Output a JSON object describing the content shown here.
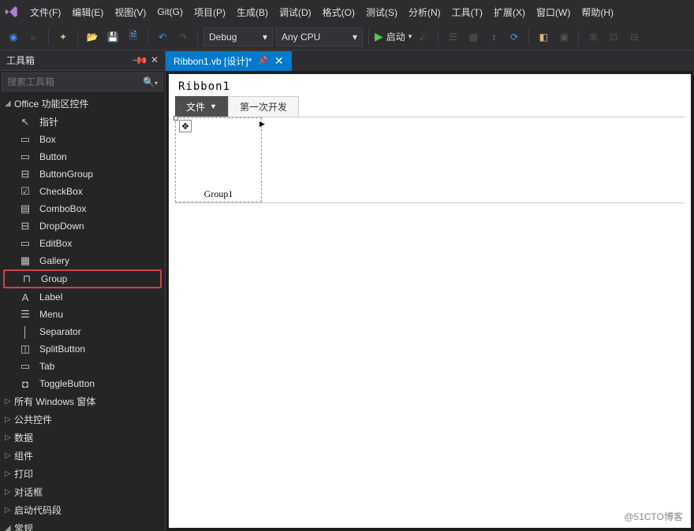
{
  "menubar": {
    "items": [
      "文件(F)",
      "编辑(E)",
      "视图(V)",
      "Git(G)",
      "项目(P)",
      "生成(B)",
      "调试(D)",
      "格式(O)",
      "测试(S)",
      "分析(N)",
      "工具(T)",
      "扩展(X)",
      "窗口(W)",
      "帮助(H)"
    ]
  },
  "toolbar": {
    "debug": "Debug",
    "cpu": "Any CPU",
    "start": "启动"
  },
  "sidebar": {
    "title": "工具箱",
    "search_placeholder": "搜索工具箱",
    "categories": {
      "office": "Office 功能区控件",
      "items": [
        {
          "icon": "pointer",
          "label": "指针"
        },
        {
          "icon": "box",
          "label": "Box"
        },
        {
          "icon": "button",
          "label": "Button"
        },
        {
          "icon": "btngrp",
          "label": "ButtonGroup"
        },
        {
          "icon": "check",
          "label": "CheckBox"
        },
        {
          "icon": "combo",
          "label": "ComboBox"
        },
        {
          "icon": "drop",
          "label": "DropDown"
        },
        {
          "icon": "edit",
          "label": "EditBox"
        },
        {
          "icon": "gallery",
          "label": "Gallery"
        },
        {
          "icon": "group",
          "label": "Group",
          "highlight": true
        },
        {
          "icon": "label",
          "label": "Label"
        },
        {
          "icon": "menu",
          "label": "Menu"
        },
        {
          "icon": "sep",
          "label": "Separator"
        },
        {
          "icon": "split",
          "label": "SplitButton"
        },
        {
          "icon": "tab",
          "label": "Tab"
        },
        {
          "icon": "toggle",
          "label": "ToggleButton"
        }
      ],
      "others": [
        "所有 Windows 窗体",
        "公共控件",
        "数据",
        "组件",
        "打印",
        "对话框",
        "启动代码段",
        "常规"
      ]
    }
  },
  "tab": {
    "title": "Ribbon1.vb [设计]*"
  },
  "designer": {
    "ribbon_title": "Ribbon1",
    "tab_file": "文件",
    "tab_dev": "第一次开发",
    "group_name": "Group1"
  },
  "watermark": "@51CTO博客"
}
